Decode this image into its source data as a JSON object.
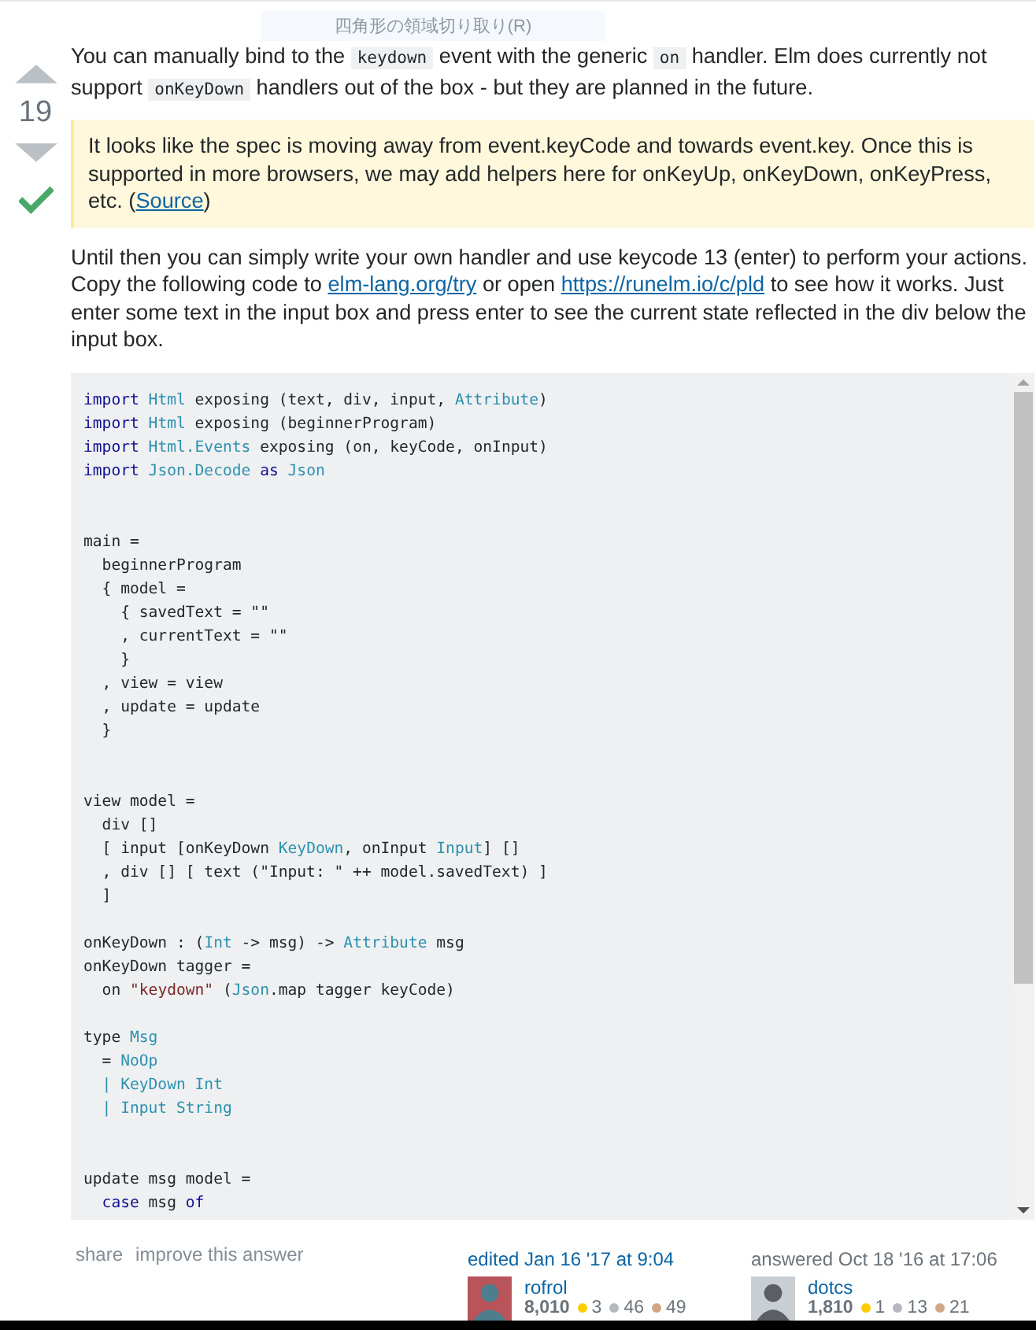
{
  "tooltip": {
    "text": "四角形の領域切り取り(R)"
  },
  "vote": {
    "score": "19",
    "accepted": true
  },
  "intro": [
    {
      "kind": "text",
      "text": "You can manually bind to the "
    },
    {
      "kind": "code",
      "text": "keydown"
    },
    {
      "kind": "text",
      "text": " event with the generic "
    },
    {
      "kind": "code",
      "text": "on"
    },
    {
      "kind": "text",
      "text": " handler. Elm does currently not support "
    },
    {
      "kind": "code",
      "text": "onKeyDown"
    },
    {
      "kind": "text",
      "text": " handlers out of the box - but they are planned in the future."
    }
  ],
  "quote": {
    "text": "It looks like the spec is moving away from event.keyCode and towards event.key. Once this is supported in more browsers, we may add helpers here for onKeyUp, onKeyDown, onKeyPress, etc. (",
    "link": "Source",
    "after": ")"
  },
  "body": [
    {
      "kind": "text",
      "text": "Until then you can simply write your own handler and use keycode 13 (enter) to perform your actions. Copy the following code to "
    },
    {
      "kind": "link",
      "text": "elm-lang.org/try"
    },
    {
      "kind": "text",
      "text": " or open "
    },
    {
      "kind": "link",
      "text": "https://runelm.io/c/pld"
    },
    {
      "kind": "text",
      "text": " to see how it works. Just enter some text in the input box and press enter to see the current state reflected in the div below the input box."
    }
  ],
  "code": [
    {
      "kind": "code",
      "segs": [
        {
          "kind": "keyword",
          "text": "import "
        },
        {
          "kind": "type",
          "text": "Html"
        },
        {
          "kind": "plain",
          "text": " exposing (text, div, input, "
        },
        {
          "kind": "type",
          "text": "Attribute"
        },
        {
          "kind": "plain",
          "text": ")"
        }
      ]
    },
    {
      "kind": "code",
      "segs": [
        {
          "kind": "keyword",
          "text": "import "
        },
        {
          "kind": "type",
          "text": "Html"
        },
        {
          "kind": "plain",
          "text": " exposing (beginnerProgram)"
        }
      ]
    },
    {
      "kind": "code",
      "segs": [
        {
          "kind": "keyword",
          "text": "import "
        },
        {
          "kind": "type",
          "text": "Html.Events"
        },
        {
          "kind": "plain",
          "text": " exposing (on, keyCode, onInput)"
        }
      ]
    },
    {
      "kind": "code",
      "segs": [
        {
          "kind": "keyword",
          "text": "import "
        },
        {
          "kind": "type",
          "text": "Json.Decode "
        },
        {
          "kind": "keyword",
          "text": "as "
        },
        {
          "kind": "type",
          "text": "Json"
        }
      ]
    },
    {
      "kind": "blank"
    },
    {
      "kind": "blank"
    },
    {
      "kind": "code",
      "segs": [
        {
          "kind": "plain",
          "text": "main ="
        }
      ]
    },
    {
      "kind": "code",
      "segs": [
        {
          "kind": "plain",
          "text": "  beginnerProgram"
        }
      ]
    },
    {
      "kind": "code",
      "segs": [
        {
          "kind": "plain",
          "text": "  { model ="
        }
      ]
    },
    {
      "kind": "code",
      "segs": [
        {
          "kind": "plain",
          "text": "    { savedText = \"\""
        }
      ]
    },
    {
      "kind": "code",
      "segs": [
        {
          "kind": "plain",
          "text": "    , currentText = \"\""
        }
      ]
    },
    {
      "kind": "code",
      "segs": [
        {
          "kind": "plain",
          "text": "    }"
        }
      ]
    },
    {
      "kind": "code",
      "segs": [
        {
          "kind": "plain",
          "text": "  , view = view"
        }
      ]
    },
    {
      "kind": "code",
      "segs": [
        {
          "kind": "plain",
          "text": "  , update = update"
        }
      ]
    },
    {
      "kind": "code",
      "segs": [
        {
          "kind": "plain",
          "text": "  }"
        }
      ]
    },
    {
      "kind": "blank"
    },
    {
      "kind": "blank"
    },
    {
      "kind": "code",
      "segs": [
        {
          "kind": "plain",
          "text": "view model ="
        }
      ]
    },
    {
      "kind": "code",
      "segs": [
        {
          "kind": "plain",
          "text": "  div []"
        }
      ]
    },
    {
      "kind": "code",
      "segs": [
        {
          "kind": "plain",
          "text": "  [ input [onKeyDown "
        },
        {
          "kind": "type",
          "text": "KeyDown"
        },
        {
          "kind": "plain",
          "text": ", onInput "
        },
        {
          "kind": "type",
          "text": "Input"
        },
        {
          "kind": "plain",
          "text": "] []"
        }
      ]
    },
    {
      "kind": "code",
      "segs": [
        {
          "kind": "plain",
          "text": "  , div [] [ text (\"Input: \" ++ model.savedText) ]"
        }
      ]
    },
    {
      "kind": "code",
      "segs": [
        {
          "kind": "plain",
          "text": "  ]"
        }
      ]
    },
    {
      "kind": "blank"
    },
    {
      "kind": "code",
      "segs": [
        {
          "kind": "plain",
          "text": "onKeyDown : ("
        },
        {
          "kind": "type",
          "text": "Int"
        },
        {
          "kind": "plain",
          "text": " -> msg) -> "
        },
        {
          "kind": "type",
          "text": "Attribute"
        },
        {
          "kind": "plain",
          "text": " msg"
        }
      ]
    },
    {
      "kind": "code",
      "segs": [
        {
          "kind": "plain",
          "text": "onKeyDown tagger ="
        }
      ]
    },
    {
      "kind": "code",
      "segs": [
        {
          "kind": "plain",
          "text": "  on "
        },
        {
          "kind": "string",
          "text": "\"keydown\""
        },
        {
          "kind": "plain",
          "text": " ("
        },
        {
          "kind": "type",
          "text": "Json"
        },
        {
          "kind": "plain",
          "text": ".map tagger keyCode)"
        }
      ]
    },
    {
      "kind": "blank"
    },
    {
      "kind": "code",
      "segs": [
        {
          "kind": "plain",
          "text": "type "
        },
        {
          "kind": "type",
          "text": "Msg"
        }
      ]
    },
    {
      "kind": "code",
      "segs": [
        {
          "kind": "plain",
          "text": "  = "
        },
        {
          "kind": "type",
          "text": "NoOp"
        }
      ]
    },
    {
      "kind": "code",
      "segs": [
        {
          "kind": "type",
          "text": "  | KeyDown Int"
        }
      ]
    },
    {
      "kind": "code",
      "segs": [
        {
          "kind": "type",
          "text": "  | Input String"
        }
      ]
    },
    {
      "kind": "blank"
    },
    {
      "kind": "blank"
    },
    {
      "kind": "code",
      "segs": [
        {
          "kind": "plain",
          "text": "update msg model ="
        }
      ]
    },
    {
      "kind": "code",
      "segs": [
        {
          "kind": "keyword",
          "text": "  case"
        },
        {
          "kind": "plain",
          "text": " msg "
        },
        {
          "kind": "keyword",
          "text": "of"
        }
      ]
    }
  ],
  "footer_links": [
    "share",
    "improve this answer"
  ],
  "cards": [
    {
      "kind": "edited",
      "action": "edited Jan 16 '17 at 9:04",
      "user": "rofrol",
      "rep": "8,010",
      "badges": [
        {
          "count": "3",
          "color": "#ffcc01"
        },
        {
          "count": "46",
          "color": "#b4b8bc"
        },
        {
          "count": "49",
          "color": "#d1a684"
        }
      ]
    },
    {
      "kind": "answered",
      "action": "answered Oct 18 '16 at 17:06",
      "user": "dotcs",
      "rep": "1,810",
      "badges": [
        {
          "count": "1",
          "color": "#ffcc01"
        },
        {
          "count": "13",
          "color": "#b4b8bc"
        },
        {
          "count": "21",
          "color": "#d1a684"
        }
      ]
    }
  ]
}
